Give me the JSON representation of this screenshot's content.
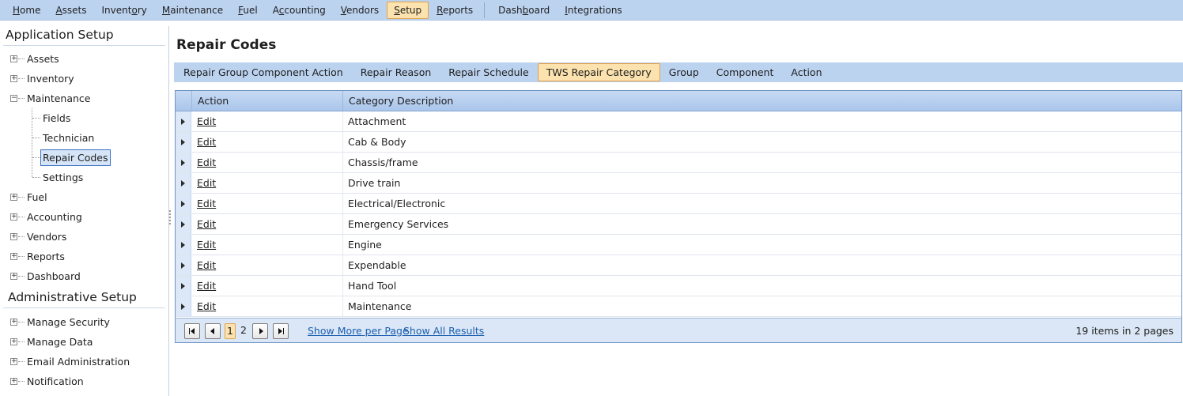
{
  "menubar": {
    "items": [
      {
        "pre": "",
        "u": "H",
        "post": "ome",
        "active": false
      },
      {
        "pre": "",
        "u": "A",
        "post": "ssets",
        "active": false
      },
      {
        "pre": "Invent",
        "u": "o",
        "post": "ry",
        "active": false
      },
      {
        "pre": "",
        "u": "M",
        "post": "aintenance",
        "active": false
      },
      {
        "pre": "",
        "u": "F",
        "post": "uel",
        "active": false
      },
      {
        "pre": "A",
        "u": "c",
        "post": "counting",
        "active": false
      },
      {
        "pre": "",
        "u": "V",
        "post": "endors",
        "active": false
      },
      {
        "pre": "",
        "u": "S",
        "post": "etup",
        "active": true
      },
      {
        "pre": "",
        "u": "R",
        "post": "eports",
        "active": false
      },
      {
        "pre": "Dash",
        "u": "b",
        "post": "oard",
        "active": false
      },
      {
        "pre": "",
        "u": "I",
        "post": "ntegrations",
        "active": false
      }
    ]
  },
  "leftpanel": {
    "app_setup_title": "Application Setup",
    "admin_setup_title": "Administrative Setup",
    "app_items": [
      "Assets",
      "Inventory",
      "Maintenance",
      "Fuel",
      "Accounting",
      "Vendors",
      "Reports",
      "Dashboard"
    ],
    "maintenance_children": [
      "Fields",
      "Technician",
      "Repair Codes",
      "Settings"
    ],
    "selected_child": "Repair Codes",
    "admin_items": [
      "Manage Security",
      "Manage Data",
      "Email Administration",
      "Notification"
    ]
  },
  "main": {
    "title": "Repair Codes",
    "tabs": [
      "Repair Group Component Action",
      "Repair Reason",
      "Repair Schedule",
      "TWS Repair Category",
      "Group",
      "Component",
      "Action"
    ],
    "active_tab": "TWS Repair Category"
  },
  "grid": {
    "columns": [
      "Action",
      "Category Description"
    ],
    "rows": [
      {
        "action": "Edit",
        "description": "Attachment"
      },
      {
        "action": "Edit",
        "description": "Cab & Body"
      },
      {
        "action": "Edit",
        "description": "Chassis/frame"
      },
      {
        "action": "Edit",
        "description": "Drive train"
      },
      {
        "action": "Edit",
        "description": "Electrical/Electronic"
      },
      {
        "action": "Edit",
        "description": "Emergency Services"
      },
      {
        "action": "Edit",
        "description": "Engine"
      },
      {
        "action": "Edit",
        "description": "Expendable"
      },
      {
        "action": "Edit",
        "description": "Hand Tool"
      },
      {
        "action": "Edit",
        "description": "Maintenance"
      }
    ]
  },
  "pager": {
    "pages": [
      "1",
      "2"
    ],
    "current_page": "1",
    "show_more_label": "Show More per Page",
    "show_all_label": "Show All Results",
    "info": "19 items in 2 pages"
  },
  "colors": {
    "menubar_bg": "#bcd3f0",
    "active_bg": "#fbe2ae",
    "active_border": "#e2a14a",
    "link": "#1b5fb0"
  }
}
